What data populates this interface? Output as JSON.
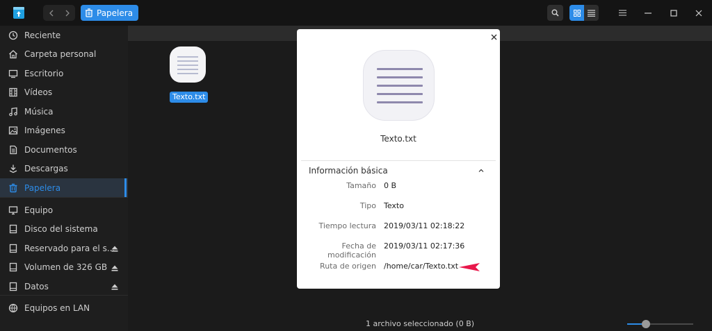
{
  "titlebar": {
    "breadcrumb": "Papelera"
  },
  "sidebar": {
    "groups": [
      [
        {
          "label": "Reciente",
          "icon": "clock-icon"
        },
        {
          "label": "Carpeta personal",
          "icon": "home-icon"
        },
        {
          "label": "Escritorio",
          "icon": "desktop-icon"
        },
        {
          "label": "Vídeos",
          "icon": "film-icon"
        },
        {
          "label": "Música",
          "icon": "music-icon"
        },
        {
          "label": "Imágenes",
          "icon": "image-icon"
        },
        {
          "label": "Documentos",
          "icon": "document-icon"
        },
        {
          "label": "Descargas",
          "icon": "download-icon"
        },
        {
          "label": "Papelera",
          "icon": "trash-icon",
          "active": true
        }
      ],
      [
        {
          "label": "Equipo",
          "icon": "monitor-icon"
        },
        {
          "label": "Disco del sistema",
          "icon": "disk-icon"
        },
        {
          "label": "Reservado para el s...",
          "icon": "disk-icon",
          "eject": true
        },
        {
          "label": "Volumen de 326 GB",
          "icon": "disk-icon",
          "eject": true
        },
        {
          "label": "Datos",
          "icon": "disk-icon",
          "eject": true
        }
      ],
      [
        {
          "label": "Equipos en LAN",
          "icon": "network-icon"
        }
      ]
    ]
  },
  "content": {
    "file": {
      "name": "Texto.txt"
    }
  },
  "statusbar": {
    "text": "1 archivo seleccionado (0 B)",
    "zoom_fraction": 0.28
  },
  "dialog": {
    "filename": "Texto.txt",
    "section_title": "Información básica",
    "rows": [
      {
        "key": "Tamaño",
        "value": "0 B"
      },
      {
        "key": "Tipo",
        "value": "Texto"
      },
      {
        "key": "Tiempo lectura",
        "value": "2019/03/11 02:18:22"
      },
      {
        "key": "Fecha de modificación",
        "value": "2019/03/11 02:17:36"
      },
      {
        "key": "Ruta de origen",
        "value": "/home/car/Texto.txt"
      }
    ]
  },
  "colors": {
    "accent": "#2d8ce8",
    "annotation_arrow": "#e8174b"
  }
}
